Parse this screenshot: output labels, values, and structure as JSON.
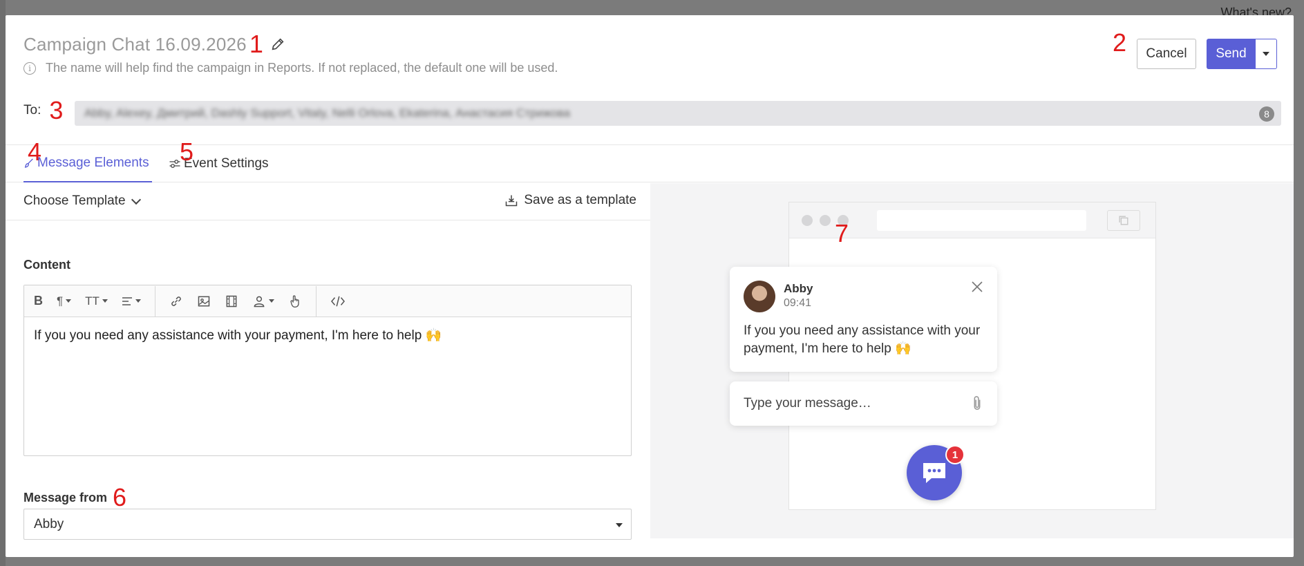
{
  "backdrop": {
    "whats_new": "What's new?"
  },
  "header": {
    "title": "Campaign Chat 16.09.2026",
    "hint": "The name will help find the campaign in Reports. If not replaced, the default one will be used.",
    "cancel_label": "Cancel",
    "send_label": "Send"
  },
  "annotations": [
    "1",
    "2",
    "3",
    "4",
    "5",
    "6",
    "7"
  ],
  "recipients": {
    "label": "To:",
    "value": "Abby, Alexey, Дмитрий, Dashly Support, Vitaly, Nelli Orlova, Ekaterina, Анастасия Стрижова",
    "count": "8"
  },
  "tabs": [
    {
      "label": "Message Elements",
      "active": true
    },
    {
      "label": "Event Settings",
      "active": false
    }
  ],
  "template": {
    "choose_label": "Choose Template",
    "save_label": "Save as a template"
  },
  "content": {
    "label": "Content",
    "text": "If you you need any assistance with your payment, I'm here to help 🙌"
  },
  "message_from": {
    "label": "Message from",
    "value": "Abby"
  },
  "preview": {
    "agent_name": "Abby",
    "agent_time": "09:41",
    "message": "If you you need any assistance with your payment, I'm here to help 🙌",
    "input_placeholder": "Type your message…",
    "unread_count": "1"
  },
  "colors": {
    "accent": "#5a5fd6",
    "badge": "#e5323a",
    "annotation": "#e01b1b"
  }
}
